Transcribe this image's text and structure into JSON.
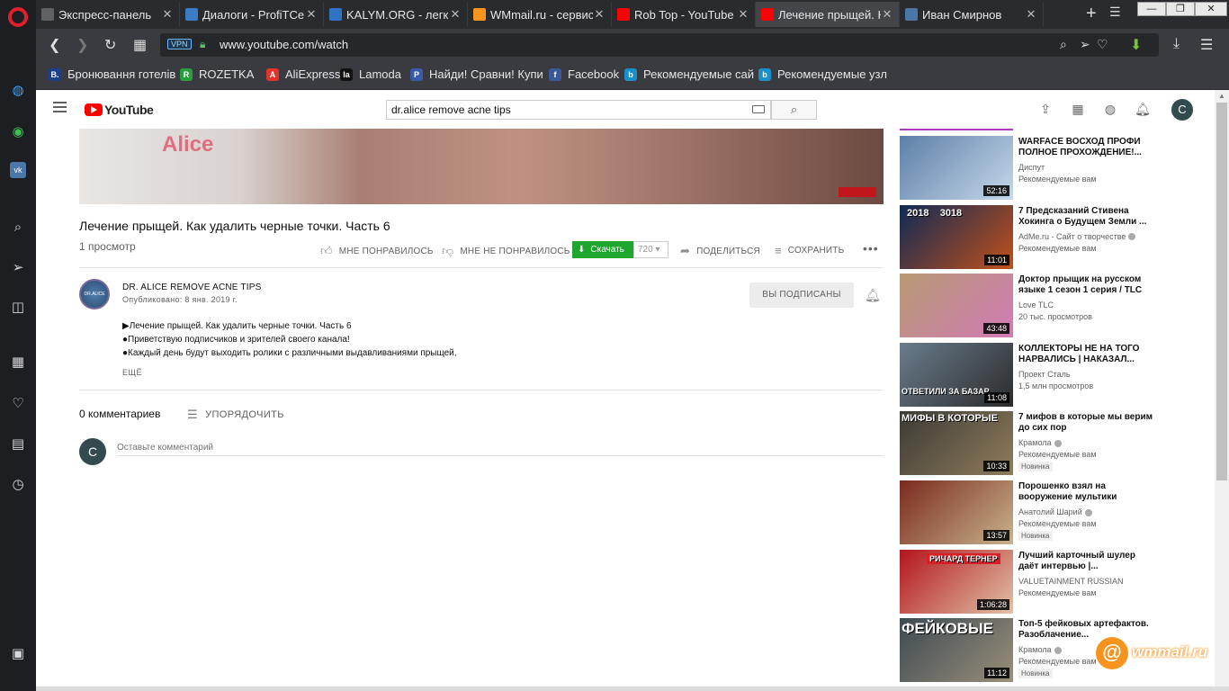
{
  "browser": {
    "tabs": [
      {
        "title": "Экспресс-панель",
        "favicon_color": "#5f6368",
        "active": false
      },
      {
        "title": "Диалоги - ProfiTCen",
        "favicon_color": "#3b7cc4",
        "active": false
      },
      {
        "title": "KALYM.ORG - легкие",
        "favicon_color": "#2f74c0",
        "active": false
      },
      {
        "title": "WMmail.ru - сервис",
        "favicon_color": "#f7941d",
        "active": false
      },
      {
        "title": "Rob Top - YouTube",
        "favicon_color": "#ff0000",
        "active": false
      },
      {
        "title": "Лечение прыщей. Ка",
        "favicon_color": "#ff0000",
        "active": true
      },
      {
        "title": "Иван Смирнов",
        "favicon_color": "#4a76a8",
        "active": false
      }
    ],
    "new_tab_label": "+",
    "url_vpn_label": "VPN",
    "url": "www.youtube.com/watch",
    "bookmarks": [
      {
        "label": "Бронювання готелів",
        "icon_letter": "B.",
        "color": "#1a3f8c"
      },
      {
        "label": "ROZETKA",
        "icon_letter": "R",
        "color": "#2a9d3e"
      },
      {
        "label": "AliExpress",
        "icon_letter": "A",
        "color": "#e4332a"
      },
      {
        "label": "Lamoda",
        "icon_letter": "la",
        "color": "#111111"
      },
      {
        "label": "Найди! Сравни! Купи",
        "icon_letter": "P",
        "color": "#3a5ca8"
      },
      {
        "label": "Facebook",
        "icon_letter": "f",
        "color": "#3b5998"
      },
      {
        "label": "Рекомендуемые сай",
        "icon_letter": "b",
        "color": "#1b8fc9"
      },
      {
        "label": "Рекомендуемые узл",
        "icon_letter": "b",
        "color": "#1b8fc9"
      }
    ]
  },
  "youtube": {
    "logo_text": "YouTube",
    "search_value": "dr.alice remove acne tips",
    "user_initial": "C",
    "video": {
      "overlay_text": "Alice",
      "title": "Лечение прыщей. Как удалить черные точки. Часть 6",
      "views": "1 просмотр",
      "like_label": "МНЕ ПОНРАВИЛОСЬ",
      "dislike_label": "МНЕ НЕ ПОНРАВИЛОСЬ",
      "download_label": "Скачать",
      "download_count": "720",
      "share_label": "ПОДЕЛИТЬСЯ",
      "save_label": "СОХРАНИТЬ"
    },
    "channel": {
      "name": "DR. ALICE REMOVE ACNE TIPS",
      "published": "Опубликовано: 8 янв. 2019 г.",
      "subscribed_label": "ВЫ ПОДПИСАНЫ"
    },
    "description": [
      "▶Лечение прыщей. Как удалить черные точки. Часть 6",
      "●Приветствую подписчиков и зрителей своего канала!",
      "●Каждый день будут выходить ролики с различными выдавливаниями прыщей,"
    ],
    "show_more": "ЕЩЁ",
    "comments": {
      "count_label": "0 комментариев",
      "sort_label": "УПОРЯДОЧИТЬ",
      "placeholder": "Оставьте комментарий",
      "user_initial": "C"
    },
    "recommendations": [
      {
        "title": "WARFACE ВОСХОД ПРОФИ ПОЛНОЕ ПРОХОЖДЕНИЕ!...",
        "channel": "Диспут",
        "verified": false,
        "stats": "Рекомендуемые вам",
        "duration": "52:16",
        "badge": "",
        "thumb_text": "",
        "c1": "#5d7fa8",
        "c2": "#c6d8ea"
      },
      {
        "title": "7 Предсказаний Стивена Хокинга о Будущем Земли ...",
        "channel": "AdMe.ru - Сайт о творчестве",
        "verified": true,
        "stats": "Рекомендуемые вам",
        "duration": "11:01",
        "badge": "",
        "thumb_text": "2018    3018",
        "c1": "#0f2a55",
        "c2": "#c2501b"
      },
      {
        "title": "Доктор прыщик на русском языке 1 сезон 1 серия / TLC",
        "channel": "Love TLC",
        "verified": false,
        "stats": "20 тыс. просмотров",
        "duration": "43:48",
        "badge": "",
        "thumb_text": "",
        "c1": "#b79a74",
        "c2": "#d17bb5"
      },
      {
        "title": "КОЛЛЕКТОРЫ НЕ НА ТОГО НАРВАЛИСЬ | НАКАЗАЛ...",
        "channel": "Проект Сталь",
        "verified": false,
        "stats": "1,5 млн просмотров",
        "duration": "11:08",
        "badge": "",
        "thumb_text": "ОТВЕТИЛИ ЗА БАЗАР",
        "c1": "#6a7c8c",
        "c2": "#2b2b2b"
      },
      {
        "title": "7 мифов в которые мы верим до сих пор",
        "channel": "Крамола",
        "verified": true,
        "stats": "Рекомендуемые вам",
        "duration": "10:33",
        "badge": "Новинка",
        "thumb_text": "МИФЫ В КОТОРЫЕ",
        "c1": "#3c3a36",
        "c2": "#8f7d5b"
      },
      {
        "title": "Порошенко взял на вооружение мультики",
        "channel": "Анатолий Шарий",
        "verified": true,
        "stats": "Рекомендуемые вам",
        "duration": "13:57",
        "badge": "Новинка",
        "thumb_text": "",
        "c1": "#7a2a1f",
        "c2": "#c9b38c"
      },
      {
        "title": "Лучший карточный шулер даёт интервью |...",
        "channel": "VALUETAINMENT RUSSIAN",
        "verified": false,
        "stats": "Рекомендуемые вам",
        "duration": "1:06:28",
        "badge": "",
        "thumb_text": "РИЧАРД ТЕРНЕР",
        "c1": "#b3141b",
        "c2": "#e0c2a8"
      },
      {
        "title": "Топ-5 фейковых артефактов. Разоблачение...",
        "channel": "Крамола",
        "verified": true,
        "stats": "Рекомендуемые вам",
        "duration": "11:12",
        "badge": "Новинка",
        "thumb_text": "ФЕЙКОВЫЕ",
        "c1": "#3d4a52",
        "c2": "#9a8f7a"
      }
    ]
  },
  "watermark": {
    "symbol": "@",
    "text": "wmmail.ru"
  }
}
